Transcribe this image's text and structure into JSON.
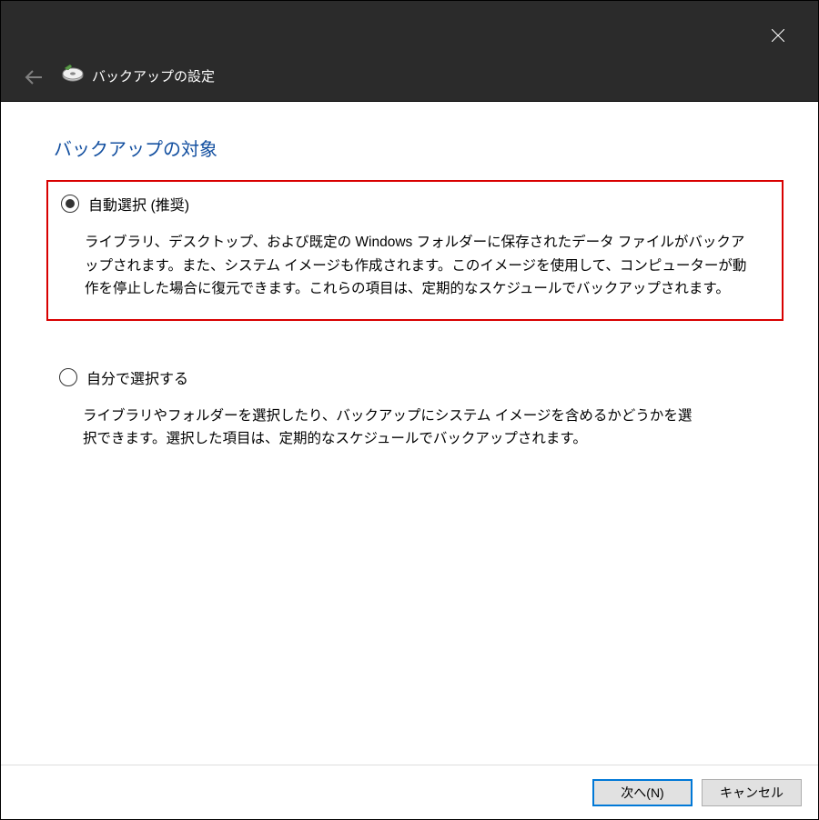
{
  "header": {
    "title": "バックアップの設定"
  },
  "main": {
    "heading": "バックアップの対象",
    "options": [
      {
        "label": "自動選択 (推奨)",
        "description": "ライブラリ、デスクトップ、および既定の Windows フォルダーに保存されたデータ ファイルがバックアップされます。また、システム イメージも作成されます。このイメージを使用して、コンピューターが動作を停止した場合に復元できます。これらの項目は、定期的なスケジュールでバックアップされます。",
        "selected": true
      },
      {
        "label": "自分で選択する",
        "description": "ライブラリやフォルダーを選択したり、バックアップにシステム イメージを含めるかどうかを選択できます。選択した項目は、定期的なスケジュールでバックアップされます。",
        "selected": false
      }
    ]
  },
  "footer": {
    "next": "次へ(N)",
    "cancel": "キャンセル"
  }
}
